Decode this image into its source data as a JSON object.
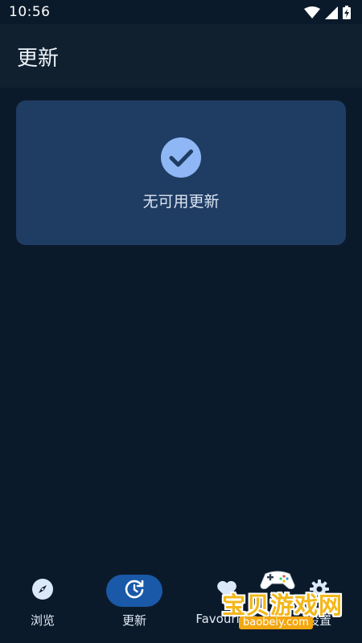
{
  "status_bar": {
    "time": "10:56",
    "icons": [
      "wifi-icon",
      "signal-icon",
      "battery-icon"
    ]
  },
  "app_bar": {
    "title": "更新"
  },
  "update_card": {
    "icon": "check-circle-icon",
    "message": "无可用更新"
  },
  "bottom_nav": {
    "items": [
      {
        "label": "浏览",
        "icon": "compass-icon",
        "active": false
      },
      {
        "label": "更新",
        "icon": "update-icon",
        "active": true
      },
      {
        "label": "Favourites",
        "icon": "heart-icon",
        "active": false
      },
      {
        "label": "设置",
        "icon": "gear-icon",
        "active": false
      }
    ]
  },
  "watermark": {
    "text": "宝贝游戏网",
    "url": "baobeiy.com"
  },
  "colors": {
    "background": "#0b1a2a",
    "app_bar": "#10202f",
    "card": "#1f3c63",
    "accent": "#8fb7f5",
    "active_pill": "#1a59a8"
  }
}
